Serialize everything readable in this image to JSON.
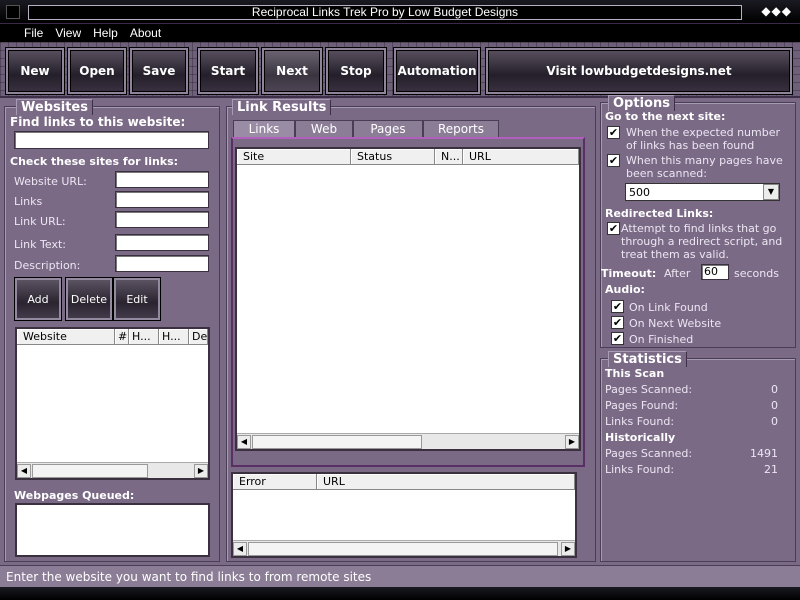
{
  "window": {
    "title": "Reciprocal Links Trek Pro by Low Budget Designs",
    "diamonds": "◆◆◆"
  },
  "menu": [
    "File",
    "View",
    "Help",
    "About"
  ],
  "toolbar": {
    "new": "New",
    "open": "Open",
    "save": "Save",
    "start": "Start",
    "next": "Next",
    "stop": "Stop",
    "automation": "Automation",
    "visit": "Visit lowbudgetdesigns.net"
  },
  "websites": {
    "title": "Websites",
    "find_label": "Find links to this website:",
    "find_value": "",
    "check_label": "Check these sites for links:",
    "fields": {
      "website_url": "Website URL:",
      "links": "Links",
      "link_url": "Link URL:",
      "link_text": "Link Text:",
      "description": "Description:"
    },
    "buttons": {
      "add": "Add",
      "delete": "Delete",
      "edit": "Edit"
    },
    "columns": [
      "Website",
      "#",
      "H...",
      "H...",
      "De"
    ],
    "queued_label": "Webpages Queued:"
  },
  "results": {
    "title": "Link Results",
    "tabs": [
      "Links",
      "Web",
      "Pages",
      "Reports"
    ],
    "columns": [
      "Site",
      "Status",
      "N...",
      "URL"
    ],
    "error_columns": [
      "Error",
      "URL"
    ]
  },
  "options": {
    "title": "Options",
    "next_site_label": "Go to the next site:",
    "opt1": "When the expected number of links has been found",
    "opt1_checked": true,
    "opt2": "When this many pages have been scanned:",
    "opt2_checked": true,
    "pages_value": "500",
    "redirect_label": "Redirected Links:",
    "redirect_opt": "Attempt to find links that go through a redirect script, and treat them as valid.",
    "redirect_checked": true,
    "timeout_label": "Timeout:",
    "after_label": "After",
    "timeout_value": "60",
    "seconds_label": "seconds",
    "audio_label": "Audio:",
    "audio": [
      {
        "label": "On Link Found",
        "checked": true
      },
      {
        "label": "On Next Website",
        "checked": true
      },
      {
        "label": "On Finished",
        "checked": true
      }
    ]
  },
  "statistics": {
    "title": "Statistics",
    "this_scan": "This Scan",
    "historically": "Historically",
    "scan": [
      {
        "label": "Pages Scanned:",
        "value": "0"
      },
      {
        "label": "Pages Found:",
        "value": "0"
      },
      {
        "label": "Links Found:",
        "value": "0"
      }
    ],
    "hist": [
      {
        "label": "Pages Scanned:",
        "value": "1491"
      },
      {
        "label": "Links Found:",
        "value": "21"
      }
    ]
  },
  "status_text": "Enter the website you want to find links to from remote sites"
}
